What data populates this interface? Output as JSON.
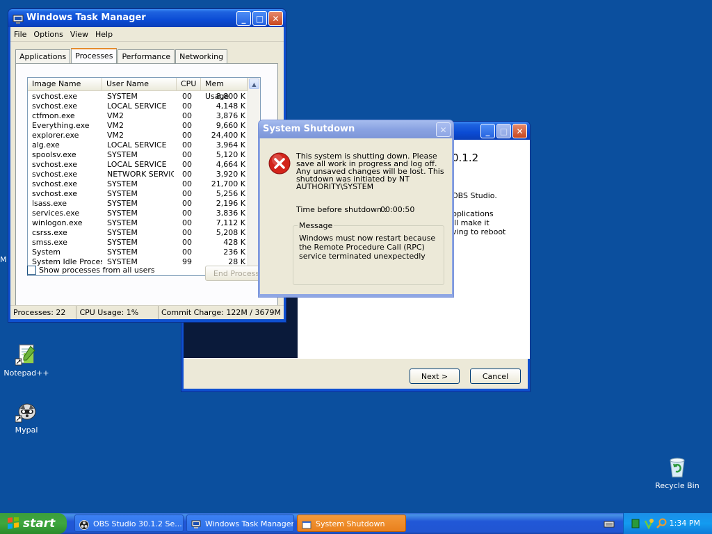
{
  "desktop": {
    "icons": [
      {
        "label": "Notepad++"
      },
      {
        "label": "Mypal"
      },
      {
        "label": "Recycle Bin"
      }
    ],
    "edge_text": "M"
  },
  "taskmanager": {
    "title": "Windows Task Manager",
    "menu": [
      "File",
      "Options",
      "View",
      "Help"
    ],
    "tabs": [
      "Applications",
      "Processes",
      "Performance",
      "Networking"
    ],
    "active_tab": "Processes",
    "columns": [
      "Image Name",
      "User Name",
      "CPU",
      "Mem Usage"
    ],
    "rows": [
      [
        "svchost.exe",
        "SYSTEM",
        "00",
        "8,800 K"
      ],
      [
        "svchost.exe",
        "LOCAL SERVICE",
        "00",
        "4,148 K"
      ],
      [
        "ctfmon.exe",
        "VM2",
        "00",
        "3,876 K"
      ],
      [
        "Everything.exe",
        "VM2",
        "00",
        "9,660 K"
      ],
      [
        "explorer.exe",
        "VM2",
        "00",
        "24,400 K"
      ],
      [
        "alg.exe",
        "LOCAL SERVICE",
        "00",
        "3,964 K"
      ],
      [
        "spoolsv.exe",
        "SYSTEM",
        "00",
        "5,120 K"
      ],
      [
        "svchost.exe",
        "LOCAL SERVICE",
        "00",
        "4,664 K"
      ],
      [
        "svchost.exe",
        "NETWORK SERVICE",
        "00",
        "3,920 K"
      ],
      [
        "svchost.exe",
        "SYSTEM",
        "00",
        "21,700 K"
      ],
      [
        "svchost.exe",
        "SYSTEM",
        "00",
        "5,256 K"
      ],
      [
        "lsass.exe",
        "SYSTEM",
        "00",
        "2,196 K"
      ],
      [
        "services.exe",
        "SYSTEM",
        "00",
        "3,836 K"
      ],
      [
        "winlogon.exe",
        "SYSTEM",
        "00",
        "7,112 K"
      ],
      [
        "csrss.exe",
        "SYSTEM",
        "00",
        "5,208 K"
      ],
      [
        "smss.exe",
        "SYSTEM",
        "00",
        "428 K"
      ],
      [
        "System",
        "SYSTEM",
        "00",
        "236 K"
      ],
      [
        "System Idle Process",
        "SYSTEM",
        "99",
        "28 K"
      ]
    ],
    "show_all_label": "Show processes from all users",
    "end_process_label": "End Process",
    "status": {
      "processes": "Processes: 22",
      "cpu": "CPU Usage: 1%",
      "commit": "Commit Charge: 122M / 3679M"
    }
  },
  "obs_setup": {
    "heading": "0.1.2",
    "line1": "OBS Studio.",
    "line2": [
      "pplications",
      "ill make it",
      "ving to reboot"
    ],
    "next_label": "Next >",
    "cancel_label": "Cancel"
  },
  "shutdown": {
    "title": "System Shutdown",
    "text": "This system is shutting down. Please save all work in progress and log off. Any unsaved changes will be lost. This shutdown was initiated by NT AUTHORITY\\SYSTEM",
    "time_label": "Time before shutdown :",
    "time_value": "00:00:50",
    "message_group_label": "Message",
    "message": "Windows must now restart because the Remote Procedure Call (RPC) service terminated unexpectedly"
  },
  "taskbar": {
    "start_label": "start",
    "buttons": [
      {
        "label": "OBS Studio 30.1.2 Se...",
        "active": false
      },
      {
        "label": "Windows Task Manager",
        "active": false
      },
      {
        "label": "System Shutdown",
        "active": true
      }
    ],
    "clock": "1:34 PM"
  },
  "colors": {
    "desktop": "#0b4f9e",
    "title_active": "#0b4bd4",
    "title_inactive": "#7a96de",
    "error_red": "#d3241a",
    "taskbar_active": "#e9801d",
    "start_green": "#3ea63e"
  }
}
